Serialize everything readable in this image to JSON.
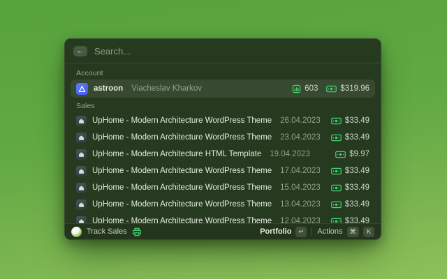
{
  "colors": {
    "accent_green": "#3fd471",
    "astroon_blue": "#4d63f2",
    "background_top": "#57a33c",
    "background_bottom": "#8ec05a"
  },
  "window": {
    "search": {
      "placeholder": "Search...",
      "value": "",
      "back_icon": "back-arrow-icon"
    },
    "account": {
      "label": "Account",
      "row": {
        "name": "astroon",
        "subtitle": "Viacheslav Kharkov",
        "sales_count": "603",
        "balance": "$319.96",
        "icons": [
          "astroon-app-icon",
          "bar-chart-icon",
          "banknote-icon"
        ]
      }
    },
    "sales": {
      "label": "Sales",
      "rows": [
        {
          "title": "UpHome - Modern Architecture WordPress Theme",
          "date": "26.04.2023",
          "price": "$33.49"
        },
        {
          "title": "UpHome - Modern Architecture WordPress Theme",
          "date": "23.04.2023",
          "price": "$33.49"
        },
        {
          "title": "UpHome - Modern Architecture HTML Template",
          "date": "19.04.2023",
          "price": "$9.97"
        },
        {
          "title": "UpHome - Modern Architecture WordPress Theme",
          "date": "17.04.2023",
          "price": "$33.49"
        },
        {
          "title": "UpHome - Modern Architecture WordPress Theme",
          "date": "15.04.2023",
          "price": "$33.49"
        },
        {
          "title": "UpHome - Modern Architecture WordPress Theme",
          "date": "13.04.2023",
          "price": "$33.49"
        },
        {
          "title": "UpHome - Modern Architecture WordPress Theme",
          "date": "12.04.2023",
          "price": "$33.49"
        }
      ]
    },
    "footer": {
      "app_name": "Track Sales",
      "primary_action": "Portfolio",
      "primary_action_key": "↵",
      "secondary_action": "Actions",
      "secondary_action_keys": [
        "⌘",
        "K"
      ],
      "back_glyph": "←"
    }
  }
}
